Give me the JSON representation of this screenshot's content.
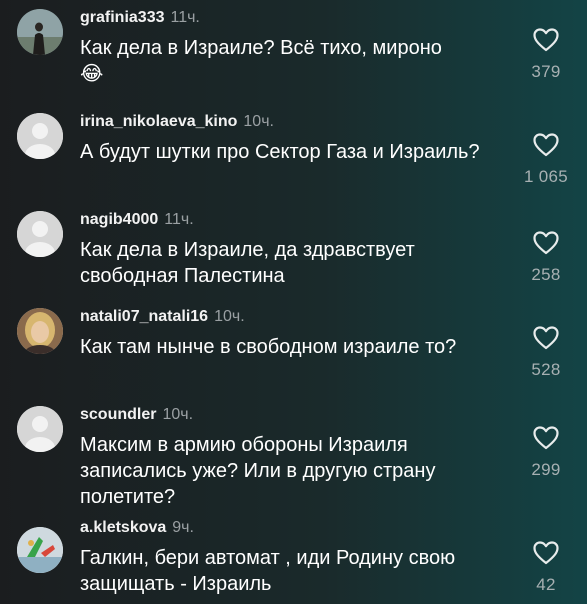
{
  "comments": [
    {
      "username": "grafinia333",
      "time": "11ч.",
      "text": "Как дела в Израиле? Всё тихо, мироно",
      "emoji": "😂",
      "likes": "379"
    },
    {
      "username": "irina_nikolaeva_kino",
      "time": "10ч.",
      "text": "А будут шутки про Сектор Газа и Израиль?",
      "likes": "1 065"
    },
    {
      "username": "nagib4000",
      "time": "11ч.",
      "text": "Как дела в Израиле, да здравствует свободная Палестина",
      "likes": "258"
    },
    {
      "username": "natali07_natali16",
      "time": "10ч.",
      "text": "Как там нынче в свободном израиле то?",
      "likes": "528"
    },
    {
      "username": "scoundler",
      "time": "10ч.",
      "text": "Максим в армию обороны Израиля записались уже? Или в другую страну полетите?",
      "likes": "299"
    },
    {
      "username": "a.kletskova",
      "time": "9ч.",
      "text": "Галкин, бери автомат , иди Родину свою защищать - Израиль",
      "likes": "42"
    }
  ],
  "icons": {
    "like": "heart-outline-icon",
    "default_avatar": "default-avatar-icon"
  }
}
